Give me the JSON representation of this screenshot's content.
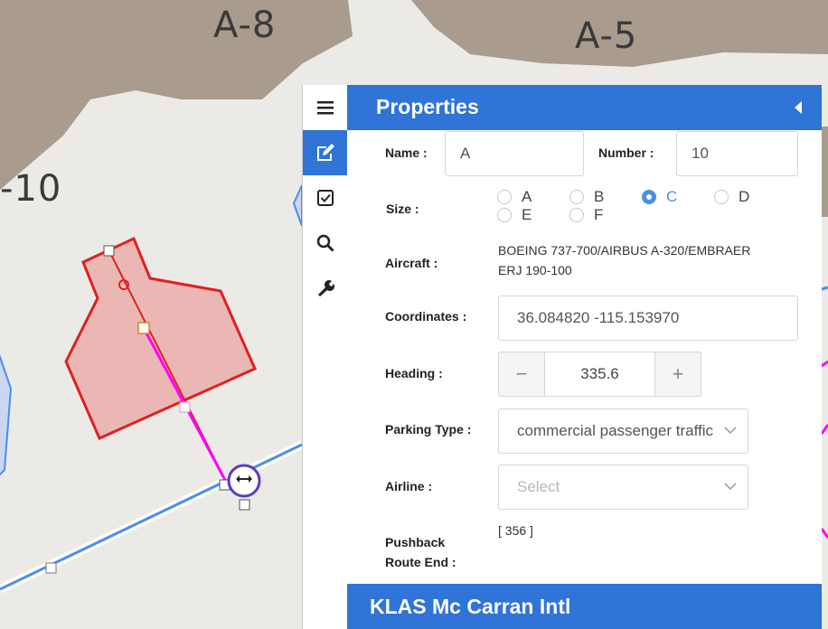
{
  "map": {
    "labels": {
      "a8": "A-8",
      "a5": "A-5",
      "a10": "-10"
    }
  },
  "toolbar": {
    "items": [
      {
        "name": "menu",
        "icon": "hamburger-menu-icon"
      },
      {
        "name": "edit",
        "icon": "edit-icon",
        "active": true
      },
      {
        "name": "check",
        "icon": "checkbox-icon"
      },
      {
        "name": "search",
        "icon": "search-icon"
      },
      {
        "name": "tools",
        "icon": "wrench-icon"
      }
    ]
  },
  "panel": {
    "title": "Properties",
    "name_label": "Name :",
    "name_value": "A",
    "number_label": "Number :",
    "number_value": "10",
    "size_label": "Size :",
    "size_options": [
      "A",
      "B",
      "C",
      "D",
      "E",
      "F"
    ],
    "size_selected": "C",
    "aircraft_label": "Aircraft :",
    "aircraft_line1": "BOEING 737-700/AIRBUS A-320/EMBRAER",
    "aircraft_line2": "ERJ 190-100",
    "coordinates_label": "Coordinates :",
    "coordinates_value": "36.084820 -115.153970",
    "heading_label": "Heading :",
    "heading_value": "335.6",
    "heading_decrement": "−",
    "heading_increment": "+",
    "parking_type_label": "Parking Type :",
    "parking_type_value": "commercial passenger traffic",
    "airline_label": "Airline :",
    "airline_placeholder": "Select",
    "pushback_label_line1": "Pushback",
    "pushback_label_line2": "Route End :",
    "pushback_value": "[ 356 ]"
  },
  "airport": {
    "name": "KLAS Mc Carran Intl"
  },
  "colors": {
    "accent": "#2f74d6",
    "radio_selected": "#4a90e2",
    "stand_fill": "#eab7b5",
    "stand_stroke": "#e02020",
    "route": "#ff00ff",
    "taxiline": "#4a8ef0",
    "building": "#a99b8d"
  }
}
